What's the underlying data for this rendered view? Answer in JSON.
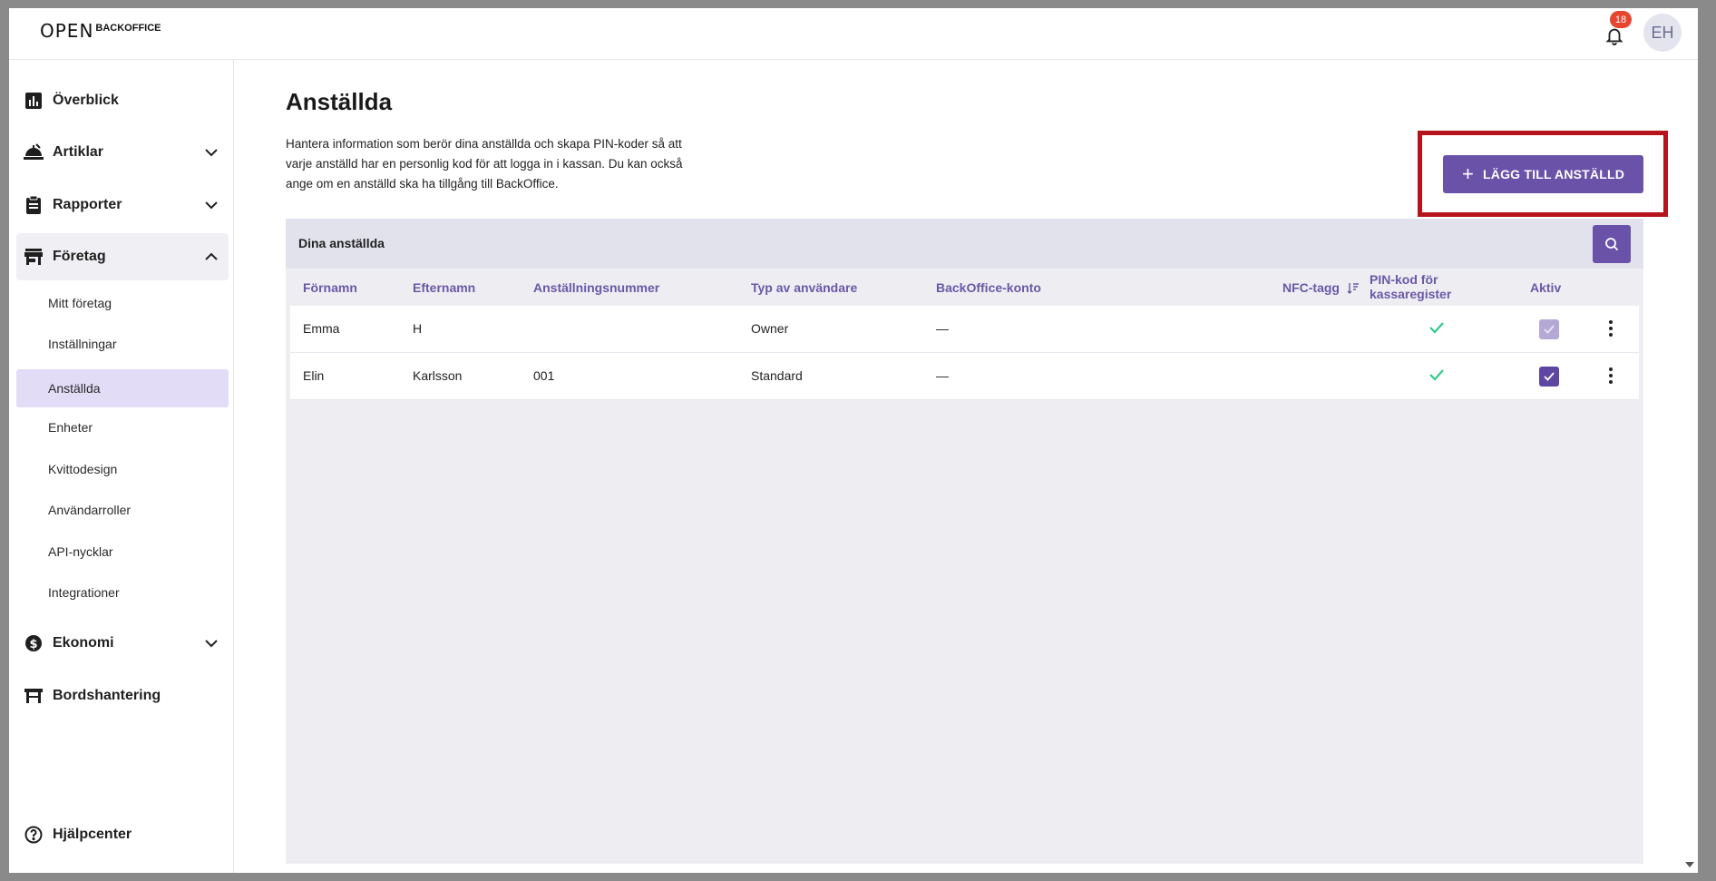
{
  "topbar": {
    "logo_text": "OPEN",
    "logo_sub": "BACKOFFICE",
    "notifications_count": "18",
    "avatar_initials": "EH"
  },
  "sidebar": {
    "items": [
      {
        "label": "Överblick",
        "icon": "chart-bars-icon"
      },
      {
        "label": "Artiklar",
        "icon": "food-tray-icon"
      },
      {
        "label": "Rapporter",
        "icon": "clipboard-icon"
      },
      {
        "label": "Företag",
        "icon": "store-icon"
      },
      {
        "label": "Ekonomi",
        "icon": "dollar-circle-icon"
      },
      {
        "label": "Bordshantering",
        "icon": "table-icon"
      }
    ],
    "company_sub_items": [
      "Mitt företag",
      "Inställningar",
      "Anställda",
      "Enheter",
      "Kvittodesign",
      "Användarroller",
      "API-nycklar",
      "Integrationer"
    ],
    "active_sub_item": "Anställda",
    "help_label": "Hjälpcenter"
  },
  "main": {
    "title": "Anställda",
    "description": "Hantera information som berör dina anställda och skapa PIN-koder så att varje anställd har en personlig kod för att logga in i kassan. Du kan också ange om en anställd ska ha tillgång till BackOffice.",
    "add_button_label": "LÄGG TILL ANSTÄLLD",
    "panel_title": "Dina anställda"
  },
  "table": {
    "columns": {
      "first_name": "Förnamn",
      "last_name": "Efternamn",
      "employee_number": "Anställningsnummer",
      "user_type": "Typ av användare",
      "backoffice_account": "BackOffice-konto",
      "nfc_tag": "NFC-tagg",
      "pin_line1": "PIN-kod för",
      "pin_line2": "kassaregister",
      "active": "Aktiv"
    },
    "rows": [
      {
        "first_name": "Emma",
        "last_name": "H",
        "employee_number": "",
        "user_type": "Owner",
        "backoffice_account": "—",
        "nfc_tag": "",
        "pin_set": true,
        "active": true,
        "active_disabled": true
      },
      {
        "first_name": "Elin",
        "last_name": "Karlsson",
        "employee_number": "001",
        "user_type": "Standard",
        "backoffice_account": "—",
        "nfc_tag": "",
        "pin_set": true,
        "active": true,
        "active_disabled": false
      }
    ]
  },
  "colors": {
    "accent": "#6a52a9",
    "header_text": "#6a58a8",
    "pin_check": "#2ecc8a",
    "highlight_box": "#b6131d",
    "badge": "#e5462f"
  }
}
